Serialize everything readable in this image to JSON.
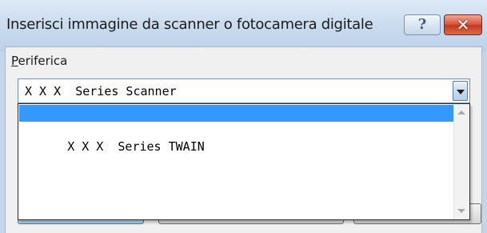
{
  "window": {
    "title": "Inserisci immagine da scanner o fotocamera digitale",
    "help_glyph": "?",
    "close_glyph": "✕"
  },
  "device": {
    "label_underlined": "P",
    "label_rest": "eriferica",
    "selected_value": "X X X  Series Scanner",
    "options": [
      {
        "label": "X X X  Series Scanner",
        "highlighted": true
      },
      {
        "label": "X X X  Series TWAIN",
        "highlighted": false
      }
    ]
  },
  "colors": {
    "highlight": "#3399ff",
    "close_button": "#c23a1e",
    "titlebar": "#c9daee"
  },
  "icons": {
    "help": "help-icon",
    "close": "close-icon",
    "dropdown_arrow": "chevron-down-icon",
    "scroll_up": "scroll-up-icon",
    "scroll_down": "scroll-down-icon"
  }
}
